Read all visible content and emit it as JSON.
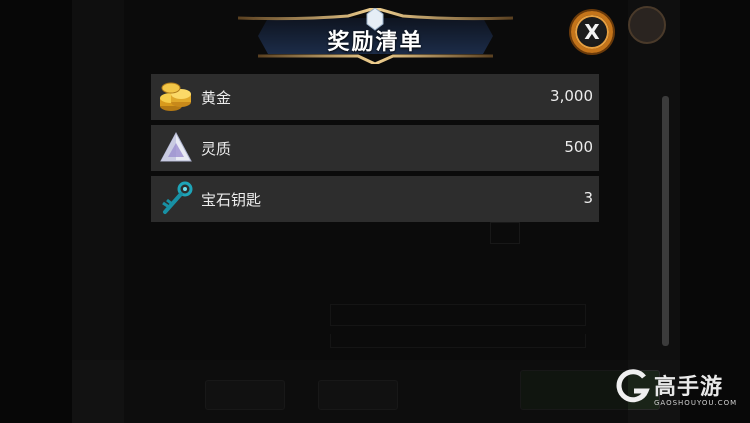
{
  "dialog": {
    "title": "奖励清单",
    "close_label": "X"
  },
  "rewards": [
    {
      "icon": "gold-coins-icon",
      "name": "黄金",
      "amount": "3,000"
    },
    {
      "icon": "crystal-pyramid-icon",
      "name": "灵质",
      "amount": "500"
    },
    {
      "icon": "gem-key-icon",
      "name": "宝石钥匙",
      "amount": "3"
    }
  ],
  "watermark": {
    "brand": "高手游",
    "url": "GAOSHOUYOU.COM"
  },
  "colors": {
    "row_bg": "#2d2d2d",
    "close_ring": "#c4741a",
    "banner_gold": "#c8a060",
    "banner_blue": "#1a2a44"
  }
}
